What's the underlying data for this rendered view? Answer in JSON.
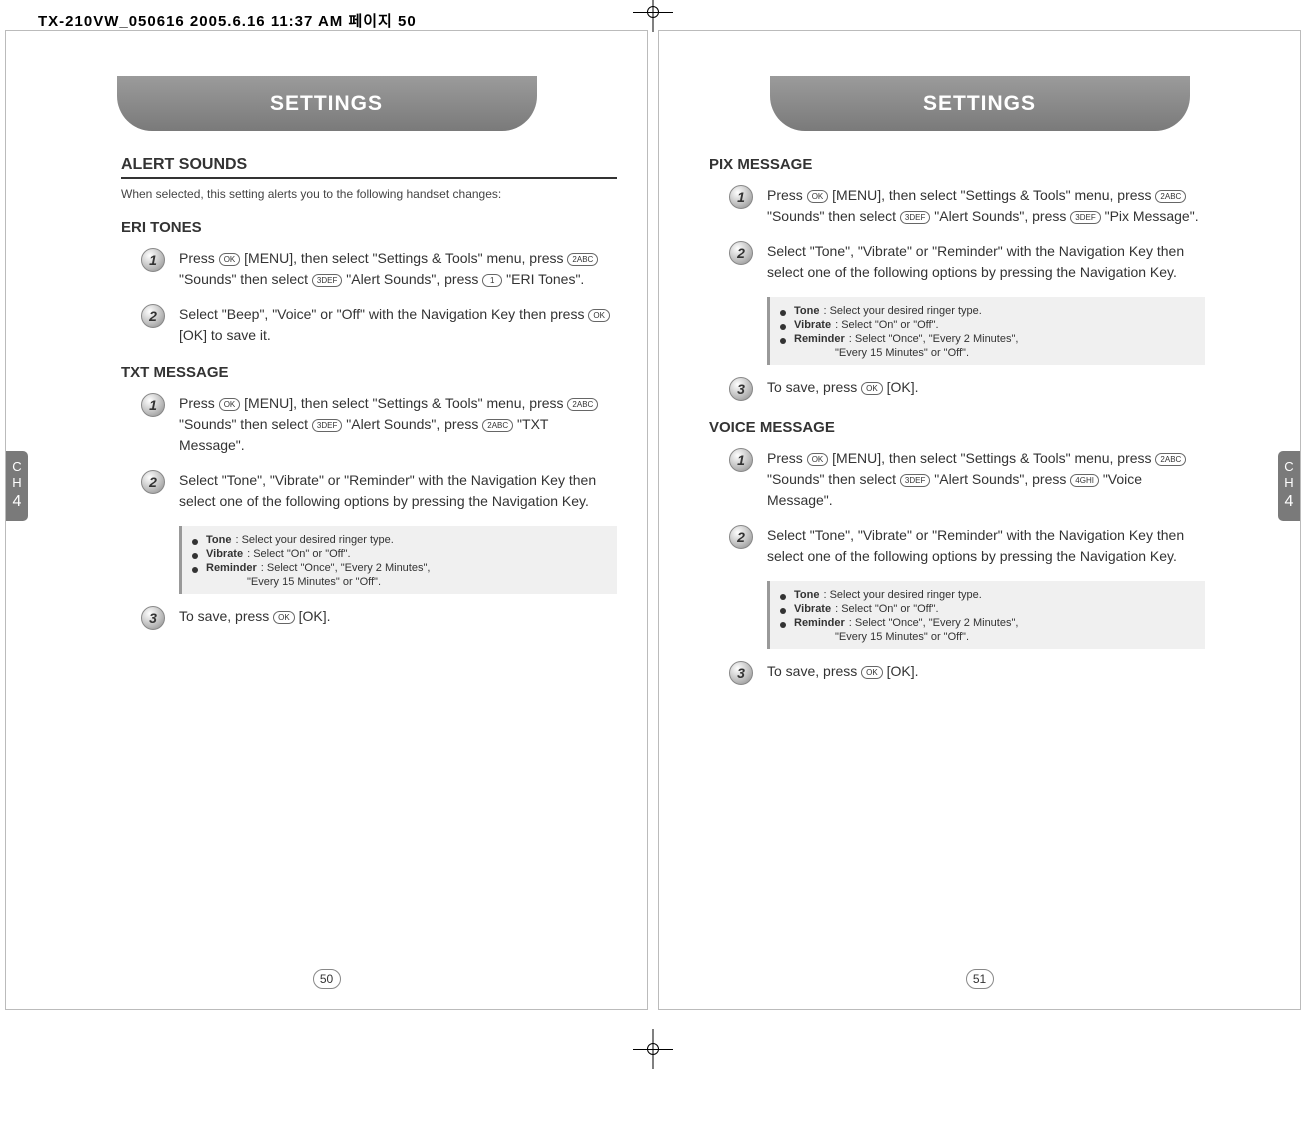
{
  "header_info": "TX-210VW_050616  2005.6.16 11:37 AM  페이지 50",
  "tab_title": "SETTINGS",
  "ch_label_1": "C",
  "ch_label_2": "H",
  "ch_label_3": "4",
  "page_left_num": "50",
  "page_right_num": "51",
  "left": {
    "section_title": "ALERT SOUNDS",
    "subtitle": "When selected, this setting alerts you to the following handset changes:",
    "eri": {
      "title": "ERI TONES",
      "step1": "Press ⓞ [MENU], then select \"Settings & Tools\" menu, press ② \"Sounds\" then select ③ \"Alert Sounds\", press ① \"ERI Tones\".",
      "step2": "Select \"Beep\", \"Voice\" or \"Off\" with the Navigation Key then press ⓞ [OK] to save it."
    },
    "txt": {
      "title": "TXT MESSAGE",
      "step1": "Press ⓞ [MENU], then select \"Settings & Tools\" menu, press ② \"Sounds\" then select ③ \"Alert Sounds\", press ② \"TXT Message\".",
      "step2": "Select \"Tone\", \"Vibrate\" or \"Reminder\" with the Navigation Key then select one of the following options by pressing the Navigation Key.",
      "step3": "To save, press ⓞ [OK]."
    }
  },
  "right": {
    "pix": {
      "title": "PIX MESSAGE",
      "step1": "Press ⓞ [MENU], then select \"Settings & Tools\" menu, press ② \"Sounds\" then select ③ \"Alert Sounds\", press ③ \"Pix Message\".",
      "step2": "Select \"Tone\", \"Vibrate\" or \"Reminder\" with the Navigation Key then select one of the following options by pressing the Navigation Key.",
      "step3": "To save, press ⓞ [OK]."
    },
    "voice": {
      "title": "VOICE MESSAGE",
      "step1": "Press ⓞ [MENU], then select \"Settings & Tools\" menu, press ② \"Sounds\" then select ③ \"Alert Sounds\", press ④ \"Voice Message\".",
      "step2": "Select \"Tone\", \"Vibrate\" or \"Reminder\" with the Navigation Key then select one of the following options by pressing the Navigation Key.",
      "step3": "To save, press ⓞ [OK]."
    }
  },
  "infobox": {
    "tone_label": "Tone",
    "tone_text": ": Select your desired ringer type.",
    "vibrate_label": "Vibrate",
    "vibrate_text": ": Select \"On\" or \"Off\".",
    "reminder_label": "Reminder",
    "reminder_text": ": Select \"Once\", \"Every 2 Minutes\",",
    "reminder_sub": "\"Every 15 Minutes\" or \"Off\"."
  }
}
